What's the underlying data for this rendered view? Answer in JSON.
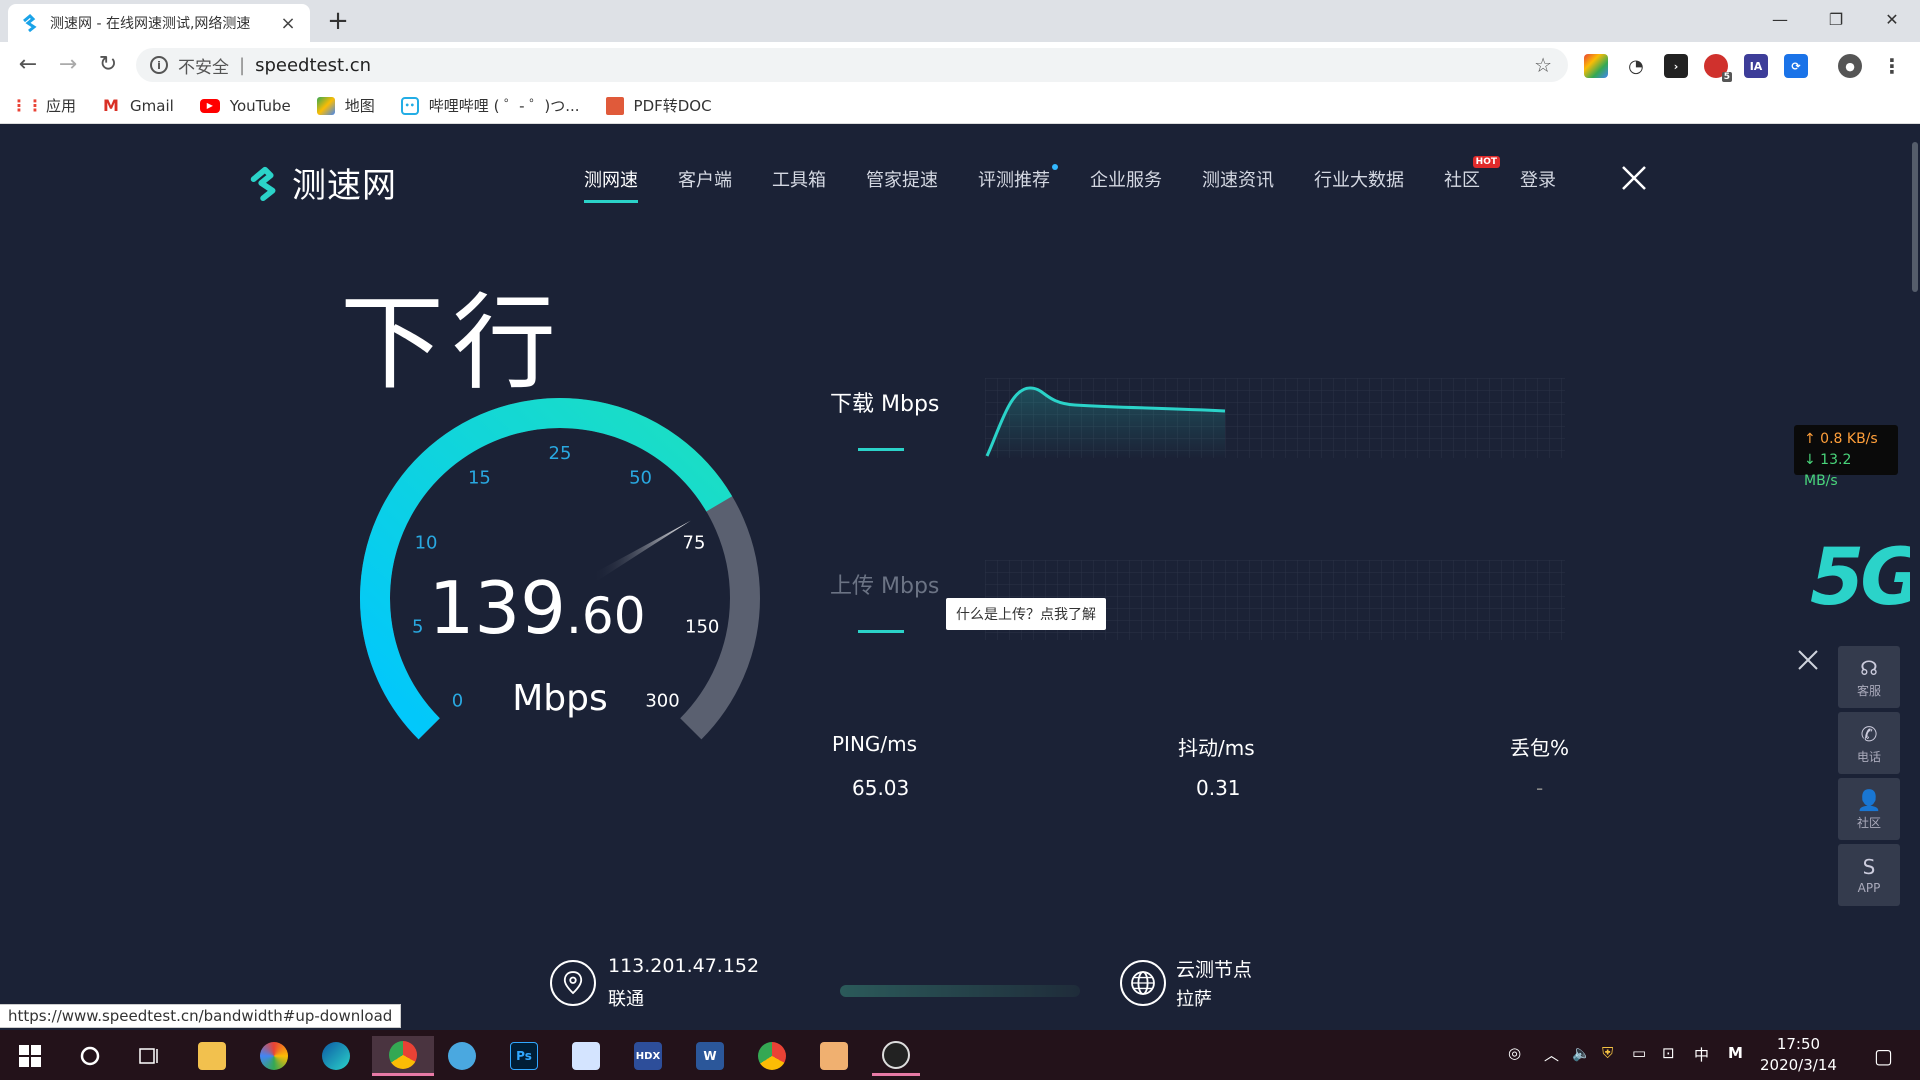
{
  "browser": {
    "tab_title": "测速网 - 在线网速测试,网络测速",
    "new_tab": "+",
    "window_minimize": "—",
    "window_restore": "❐",
    "window_close": "✕",
    "security_label": "不安全",
    "url": "speedtest.cn",
    "extension_abp_badge": "5",
    "extension_ia": "IA",
    "bookmarks": [
      {
        "label": "应用",
        "icon": "apps-grid-icon"
      },
      {
        "label": "Gmail",
        "icon": "gmail-icon"
      },
      {
        "label": "YouTube",
        "icon": "youtube-icon"
      },
      {
        "label": "地图",
        "icon": "maps-icon"
      },
      {
        "label": "哔哩哔哩 ( ゜- ゜)つ...",
        "icon": "bilibili-icon"
      },
      {
        "label": "PDF转DOC",
        "icon": "pdf-icon"
      }
    ],
    "status_url": "https://www.speedtest.cn/bandwidth#up-download"
  },
  "site": {
    "logo_text": "测速网",
    "nav": [
      {
        "label": "测网速",
        "active": true
      },
      {
        "label": "客户端"
      },
      {
        "label": "工具箱"
      },
      {
        "label": "管家提速"
      },
      {
        "label": "评测推荐",
        "dot": true
      },
      {
        "label": "企业服务"
      },
      {
        "label": "测速资讯"
      },
      {
        "label": "行业大数据"
      },
      {
        "label": "社区",
        "hot": "HOT"
      },
      {
        "label": "登录"
      }
    ]
  },
  "test": {
    "direction": "下行",
    "speed_int": "139",
    "speed_dec": ".60",
    "unit": "Mbps",
    "gauge_ticks": [
      "0",
      "5",
      "10",
      "15",
      "25",
      "50",
      "75",
      "150",
      "300"
    ],
    "gauge_fraction": 0.72,
    "download_label": "下载 Mbps",
    "upload_label": "上传 Mbps",
    "upload_tooltip": "什么是上传？点我了解",
    "ping_label": "PING/ms",
    "ping_value": "65.03",
    "jitter_label": "抖动/ms",
    "jitter_value": "0.31",
    "loss_label": "丢包%",
    "loss_value": "-",
    "ip": "113.201.47.152",
    "isp": "联通",
    "node_label": "云测节点",
    "node_city": "拉萨"
  },
  "side": {
    "speed_up": "↑ 0.8 KB/s",
    "speed_down": "↓ 13.2 MB/s",
    "fiveg": "5G",
    "buttons": [
      {
        "label": "客服",
        "icon": "headset-icon",
        "glyph": "☊"
      },
      {
        "label": "电话",
        "icon": "phone-icon",
        "glyph": "✆"
      },
      {
        "label": "社区",
        "icon": "community-icon",
        "glyph": "👤"
      },
      {
        "label": "APP",
        "icon": "app-icon",
        "glyph": "S"
      }
    ]
  },
  "taskbar": {
    "time": "17:50",
    "date": "2020/3/14",
    "ime_label": "中",
    "ps_label": "Ps",
    "hdx_label": "HDX",
    "word_label": "W",
    "m_label": "M"
  },
  "colors": {
    "accent": "#2bd3c9",
    "gauge_start": "#00c6ff",
    "page_bg": "#1b2236"
  }
}
